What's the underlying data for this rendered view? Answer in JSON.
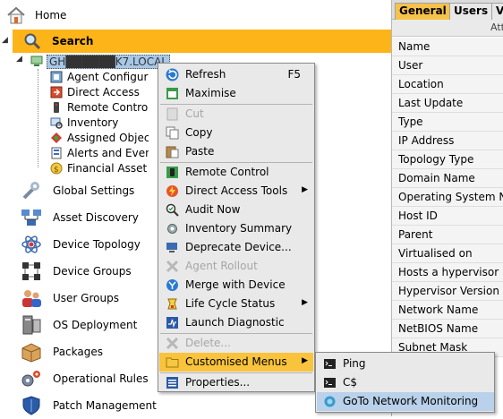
{
  "tree": {
    "home_label": "Home",
    "search_label": "Search",
    "node_label": "GH██████K7.LOCAL",
    "children": [
      {
        "label": "Agent Configuration",
        "icon": "agent-config-icon"
      },
      {
        "label": "Direct Access",
        "icon": "direct-access-icon"
      },
      {
        "label": "Remote Control",
        "icon": "remote-control-icon"
      },
      {
        "label": "Inventory",
        "icon": "inventory-icon"
      },
      {
        "label": "Assigned Objects",
        "icon": "assigned-objects-icon"
      },
      {
        "label": "Alerts and Events",
        "icon": "alerts-icon"
      },
      {
        "label": "Financial Asset",
        "icon": "financial-asset-icon"
      }
    ],
    "modules": [
      {
        "label": "Global Settings",
        "icon": "wrench-icon"
      },
      {
        "label": "Asset Discovery",
        "icon": "asset-discovery-icon"
      },
      {
        "label": "Device Topology",
        "icon": "atom-icon"
      },
      {
        "label": "Device Groups",
        "icon": "device-groups-icon"
      },
      {
        "label": "User Groups",
        "icon": "user-groups-icon"
      },
      {
        "label": "OS Deployment",
        "icon": "os-deployment-icon"
      },
      {
        "label": "Packages",
        "icon": "package-icon"
      },
      {
        "label": "Operational Rules",
        "icon": "gears-icon"
      },
      {
        "label": "Patch Management",
        "icon": "shield-icon"
      }
    ]
  },
  "props": {
    "tabs": [
      "General",
      "Users",
      "Vi"
    ],
    "col_header": "Att",
    "rows": [
      "Name",
      "User",
      "Location",
      "Last Update",
      "Type",
      "IP Address",
      "Topology Type",
      "Domain Name",
      "Operating System Na",
      "Host ID",
      "Parent",
      "Virtualised on",
      "Hosts a hypervisor",
      "Hypervisor Version",
      "Network Name",
      "NetBIOS Name",
      "Subnet Mask"
    ]
  },
  "context_menu": {
    "items": [
      {
        "label": "Refresh",
        "shortcut": "F5"
      },
      {
        "label": "Maximise"
      },
      {
        "label": "Cut"
      },
      {
        "label": "Copy"
      },
      {
        "label": "Paste"
      },
      {
        "label": "Remote Control"
      },
      {
        "label": "Direct Access Tools"
      },
      {
        "label": "Audit Now"
      },
      {
        "label": "Inventory Summary"
      },
      {
        "label": "Deprecate Device..."
      },
      {
        "label": "Agent Rollout"
      },
      {
        "label": "Merge with Device"
      },
      {
        "label": "Life Cycle Status"
      },
      {
        "label": "Launch Diagnostic"
      },
      {
        "label": "Delete..."
      },
      {
        "label": "Customised Menus"
      },
      {
        "label": "Properties..."
      }
    ]
  },
  "submenu": {
    "items": [
      {
        "label": "Ping"
      },
      {
        "label": "C$"
      },
      {
        "label": "GoTo Network Monitoring"
      }
    ]
  },
  "colors": {
    "accent": "#fcb419",
    "selection": "#b9d1ea",
    "menu_bg": "#e9e9e9"
  }
}
